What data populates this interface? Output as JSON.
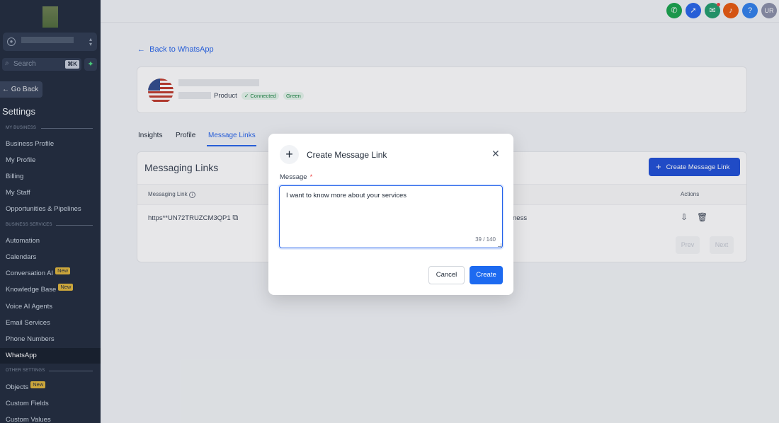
{
  "sidebar": {
    "search_placeholder": "Search",
    "search_shortcut": "⌘K",
    "go_back": "Go Back",
    "title": "Settings",
    "sections": {
      "my_business": "MY BUSINESS",
      "business_services": "BUSINESS SERVICES",
      "other_settings": "OTHER SETTINGS"
    },
    "items": {
      "business_profile": "Business Profile",
      "my_profile": "My Profile",
      "billing": "Billing",
      "my_staff": "My Staff",
      "opportunities": "Opportunities & Pipelines",
      "automation": "Automation",
      "calendars": "Calendars",
      "conversation_ai": "Conversation AI",
      "knowledge_base": "Knowledge Base",
      "voice_ai": "Voice AI Agents",
      "email_services": "Email Services",
      "phone_numbers": "Phone Numbers",
      "whatsapp": "WhatsApp",
      "objects": "Objects",
      "custom_fields": "Custom Fields",
      "custom_values": "Custom Values"
    },
    "new_badge": "New"
  },
  "topbar": {
    "avatar_initials": "UR",
    "help": "?",
    "colors": {
      "phone": "#16a34a",
      "launch": "#2563eb",
      "megaphone": "#1f9d6b",
      "bell": "#ea580c",
      "help": "#2f80ed",
      "avatar": "#8a8fa8"
    }
  },
  "main": {
    "back_link": "Back to WhatsApp",
    "account": {
      "product": "Product",
      "status": "Connected",
      "quality": "Green"
    },
    "tabs": [
      "Insights",
      "Profile",
      "Message Links"
    ],
    "links_card": {
      "title": "Messaging Links",
      "create_button": "Create Message Link",
      "col_link": "Messaging Link",
      "col_actions": "Actions",
      "row_link": "https**UN72TRUZCM3QP1",
      "row_partial": "ness",
      "prev": "Prev",
      "next": "Next"
    }
  },
  "modal": {
    "title": "Create Message Link",
    "label": "Message",
    "required_mark": "*",
    "value": "I want to know more about your services",
    "counter": "39 / 140",
    "cancel": "Cancel",
    "create": "Create"
  }
}
